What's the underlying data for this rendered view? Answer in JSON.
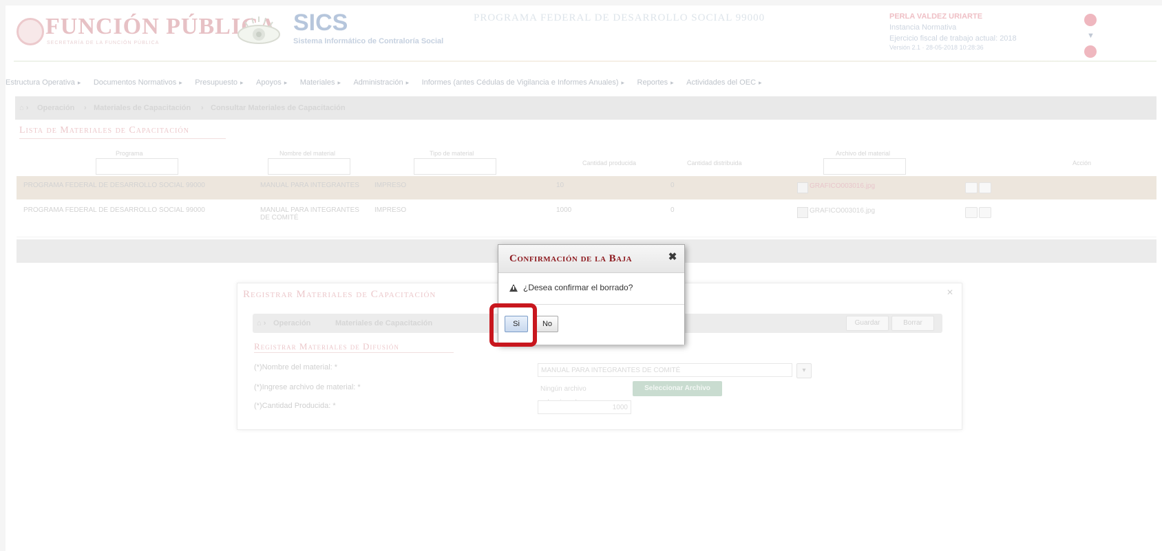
{
  "header": {
    "brand_name": "FUNCIÓN PÚBLICA",
    "brand_sub": "SECRETARÍA DE LA FUNCIÓN PÚBLICA",
    "app_name": "SICS",
    "app_subtitle": "Sistema Informático de Contraloría Social",
    "program_name": "PROGRAMA FEDERAL DE DESARROLLO SOCIAL 99000",
    "user_name": "PERLA VALDEZ URIARTE",
    "user_role": "Instancia Normativa",
    "user_fiscal_year": "Ejercicio fiscal de trabajo actual: 2018",
    "user_version": "Versión 2.1 · 28-05-2018 10:28:36"
  },
  "menu": {
    "items": [
      "Estructura Operativa",
      "Documentos Normativos",
      "Presupuesto",
      "Apoyos",
      "Materiales",
      "Administración",
      "Informes (antes Cédulas de Vigilancia e Informes Anuales)",
      "Reportes",
      "Actividades del OEC"
    ]
  },
  "breadcrumb": {
    "items": [
      "Operación",
      "Materiales de Capacitación",
      "Consultar Materiales de Capacitación"
    ]
  },
  "list_section": {
    "title": "Lista de Materiales de Capacitación",
    "columns": [
      "Programa",
      "Nombre del material",
      "Tipo de material",
      "Cantidad producida",
      "Cantidad distribuida",
      "Archivo del material",
      "Acción"
    ],
    "rows": [
      {
        "program": "PROGRAMA FEDERAL DE DESARROLLO SOCIAL 99000",
        "material": "MANUAL PARA INTEGRANTES",
        "type": "IMPRESO",
        "produced": "10",
        "distributed": "0",
        "file": "GRAFICO003016.jpg"
      },
      {
        "program": "PROGRAMA FEDERAL DE DESARROLLO SOCIAL 99000",
        "material": "MANUAL PARA INTEGRANTES DE COMITÉ",
        "type": "IMPRESO",
        "produced": "1000",
        "distributed": "0",
        "file": "GRAFICO003016.jpg"
      }
    ]
  },
  "form_dialog": {
    "title": "Registrar Materiales de Capacitación",
    "breadcrumb": [
      "Operación",
      "Materiales de Capacitación"
    ],
    "save_label": "Guardar",
    "cancel_label": "Borrar",
    "section_title": "Registrar Materiales de Difusión",
    "fields": {
      "material_name_label": "(*)Nombre del material: *",
      "material_name_value": "MANUAL PARA INTEGRANTES DE COMITÉ",
      "file_label": "(*)Ingrese archivo de material: *",
      "file_placeholder": "Ningún archivo seleccionado",
      "select_file_label": "Seleccionar Archivo",
      "quantity_label": "(*)Cantidad Producida: *",
      "quantity_value": "1000"
    }
  },
  "confirm_dialog": {
    "title": "Confirmación de la Baja",
    "message": "¿Desea confirmar el borrado?",
    "yes_label": "Si",
    "no_label": "No",
    "close_glyph": "✖"
  }
}
